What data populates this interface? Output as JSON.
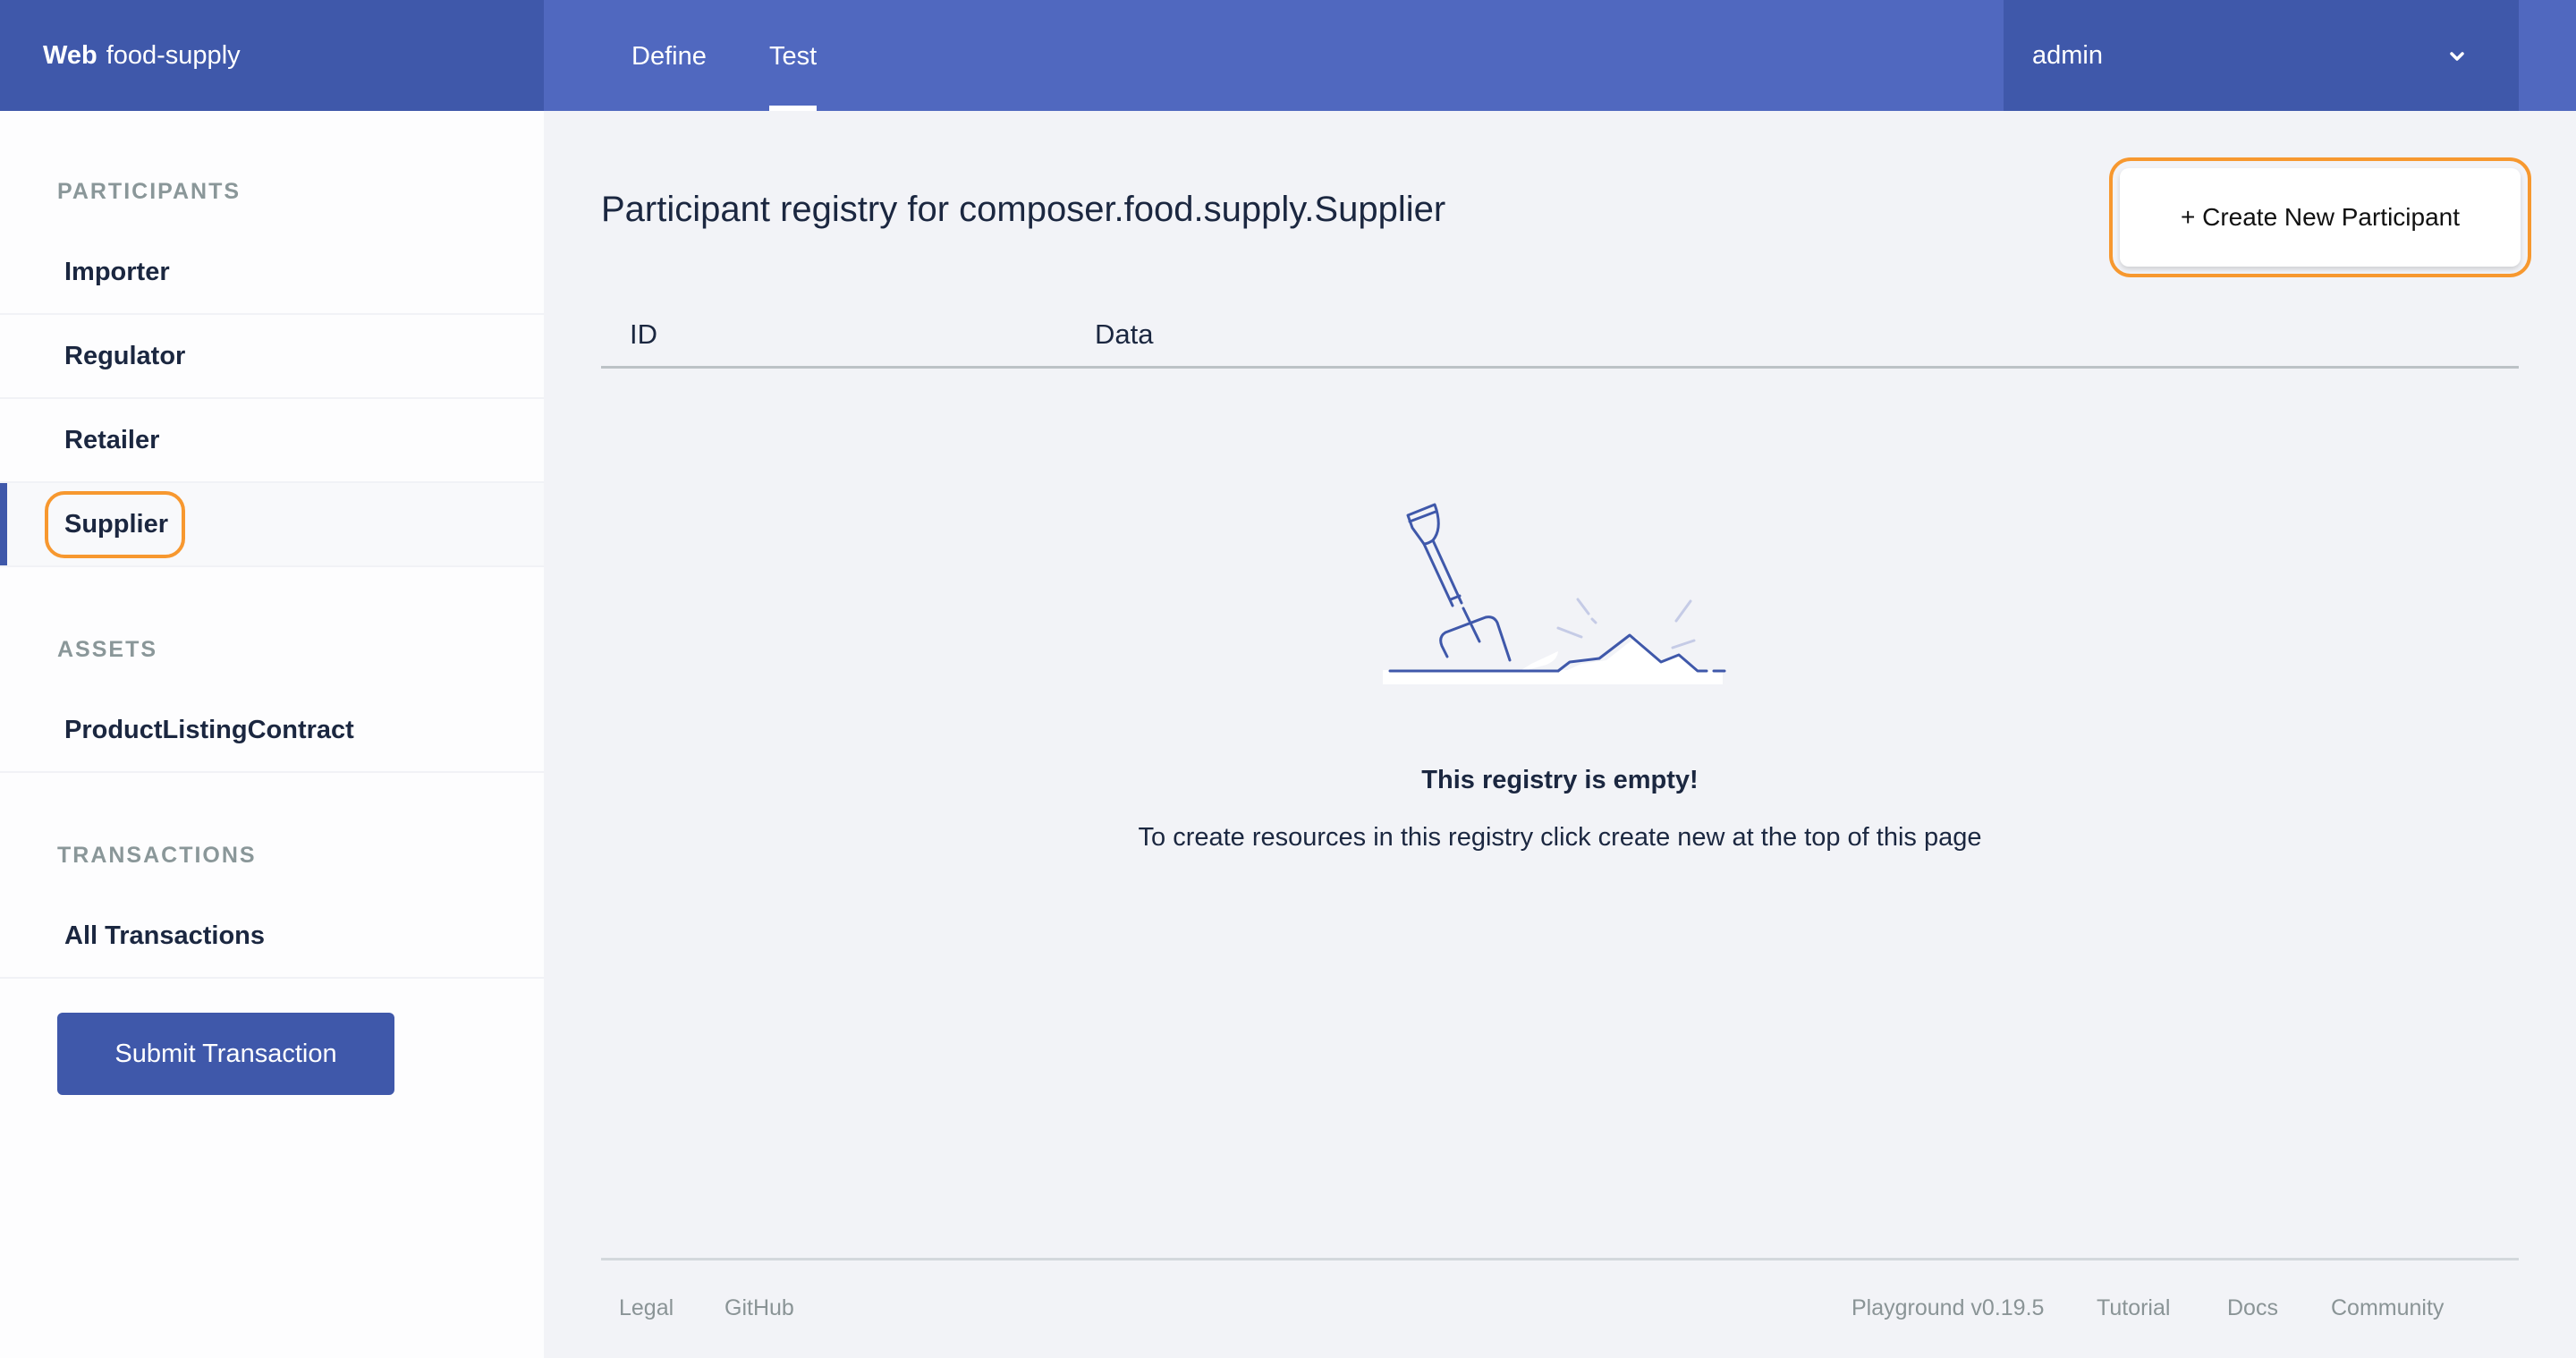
{
  "header": {
    "brand_bold": "Web",
    "brand_name": "food-supply",
    "tabs": [
      {
        "label": "Define",
        "active": false
      },
      {
        "label": "Test",
        "active": true
      }
    ],
    "user": "admin",
    "user_icon": "chevron-down-icon"
  },
  "sidebar": {
    "sections": [
      {
        "title": "PARTICIPANTS",
        "items": [
          "Importer",
          "Regulator",
          "Retailer",
          "Supplier"
        ]
      },
      {
        "title": "ASSETS",
        "items": [
          "ProductListingContract"
        ]
      },
      {
        "title": "TRANSACTIONS",
        "items": [
          "All Transactions"
        ]
      }
    ],
    "active_item": "Supplier",
    "submit_label": "Submit Transaction"
  },
  "main": {
    "title": "Participant registry for composer.food.supply.Supplier",
    "create_label": "+ Create New Participant",
    "columns": [
      "ID",
      "Data"
    ],
    "empty_icon": "shovel-icon",
    "empty_title": "This registry is empty!",
    "empty_sub": "To create resources in this registry click create new at the top of this page"
  },
  "footer": {
    "left_links": [
      "Legal",
      "GitHub"
    ],
    "version": "Playground v0.19.5",
    "right_links": [
      "Tutorial",
      "Docs",
      "Community"
    ]
  },
  "colors": {
    "primary": "#3f58aa",
    "header_nav": "#5068bf",
    "highlight": "#f7982f",
    "background": "#f2f3f7"
  }
}
